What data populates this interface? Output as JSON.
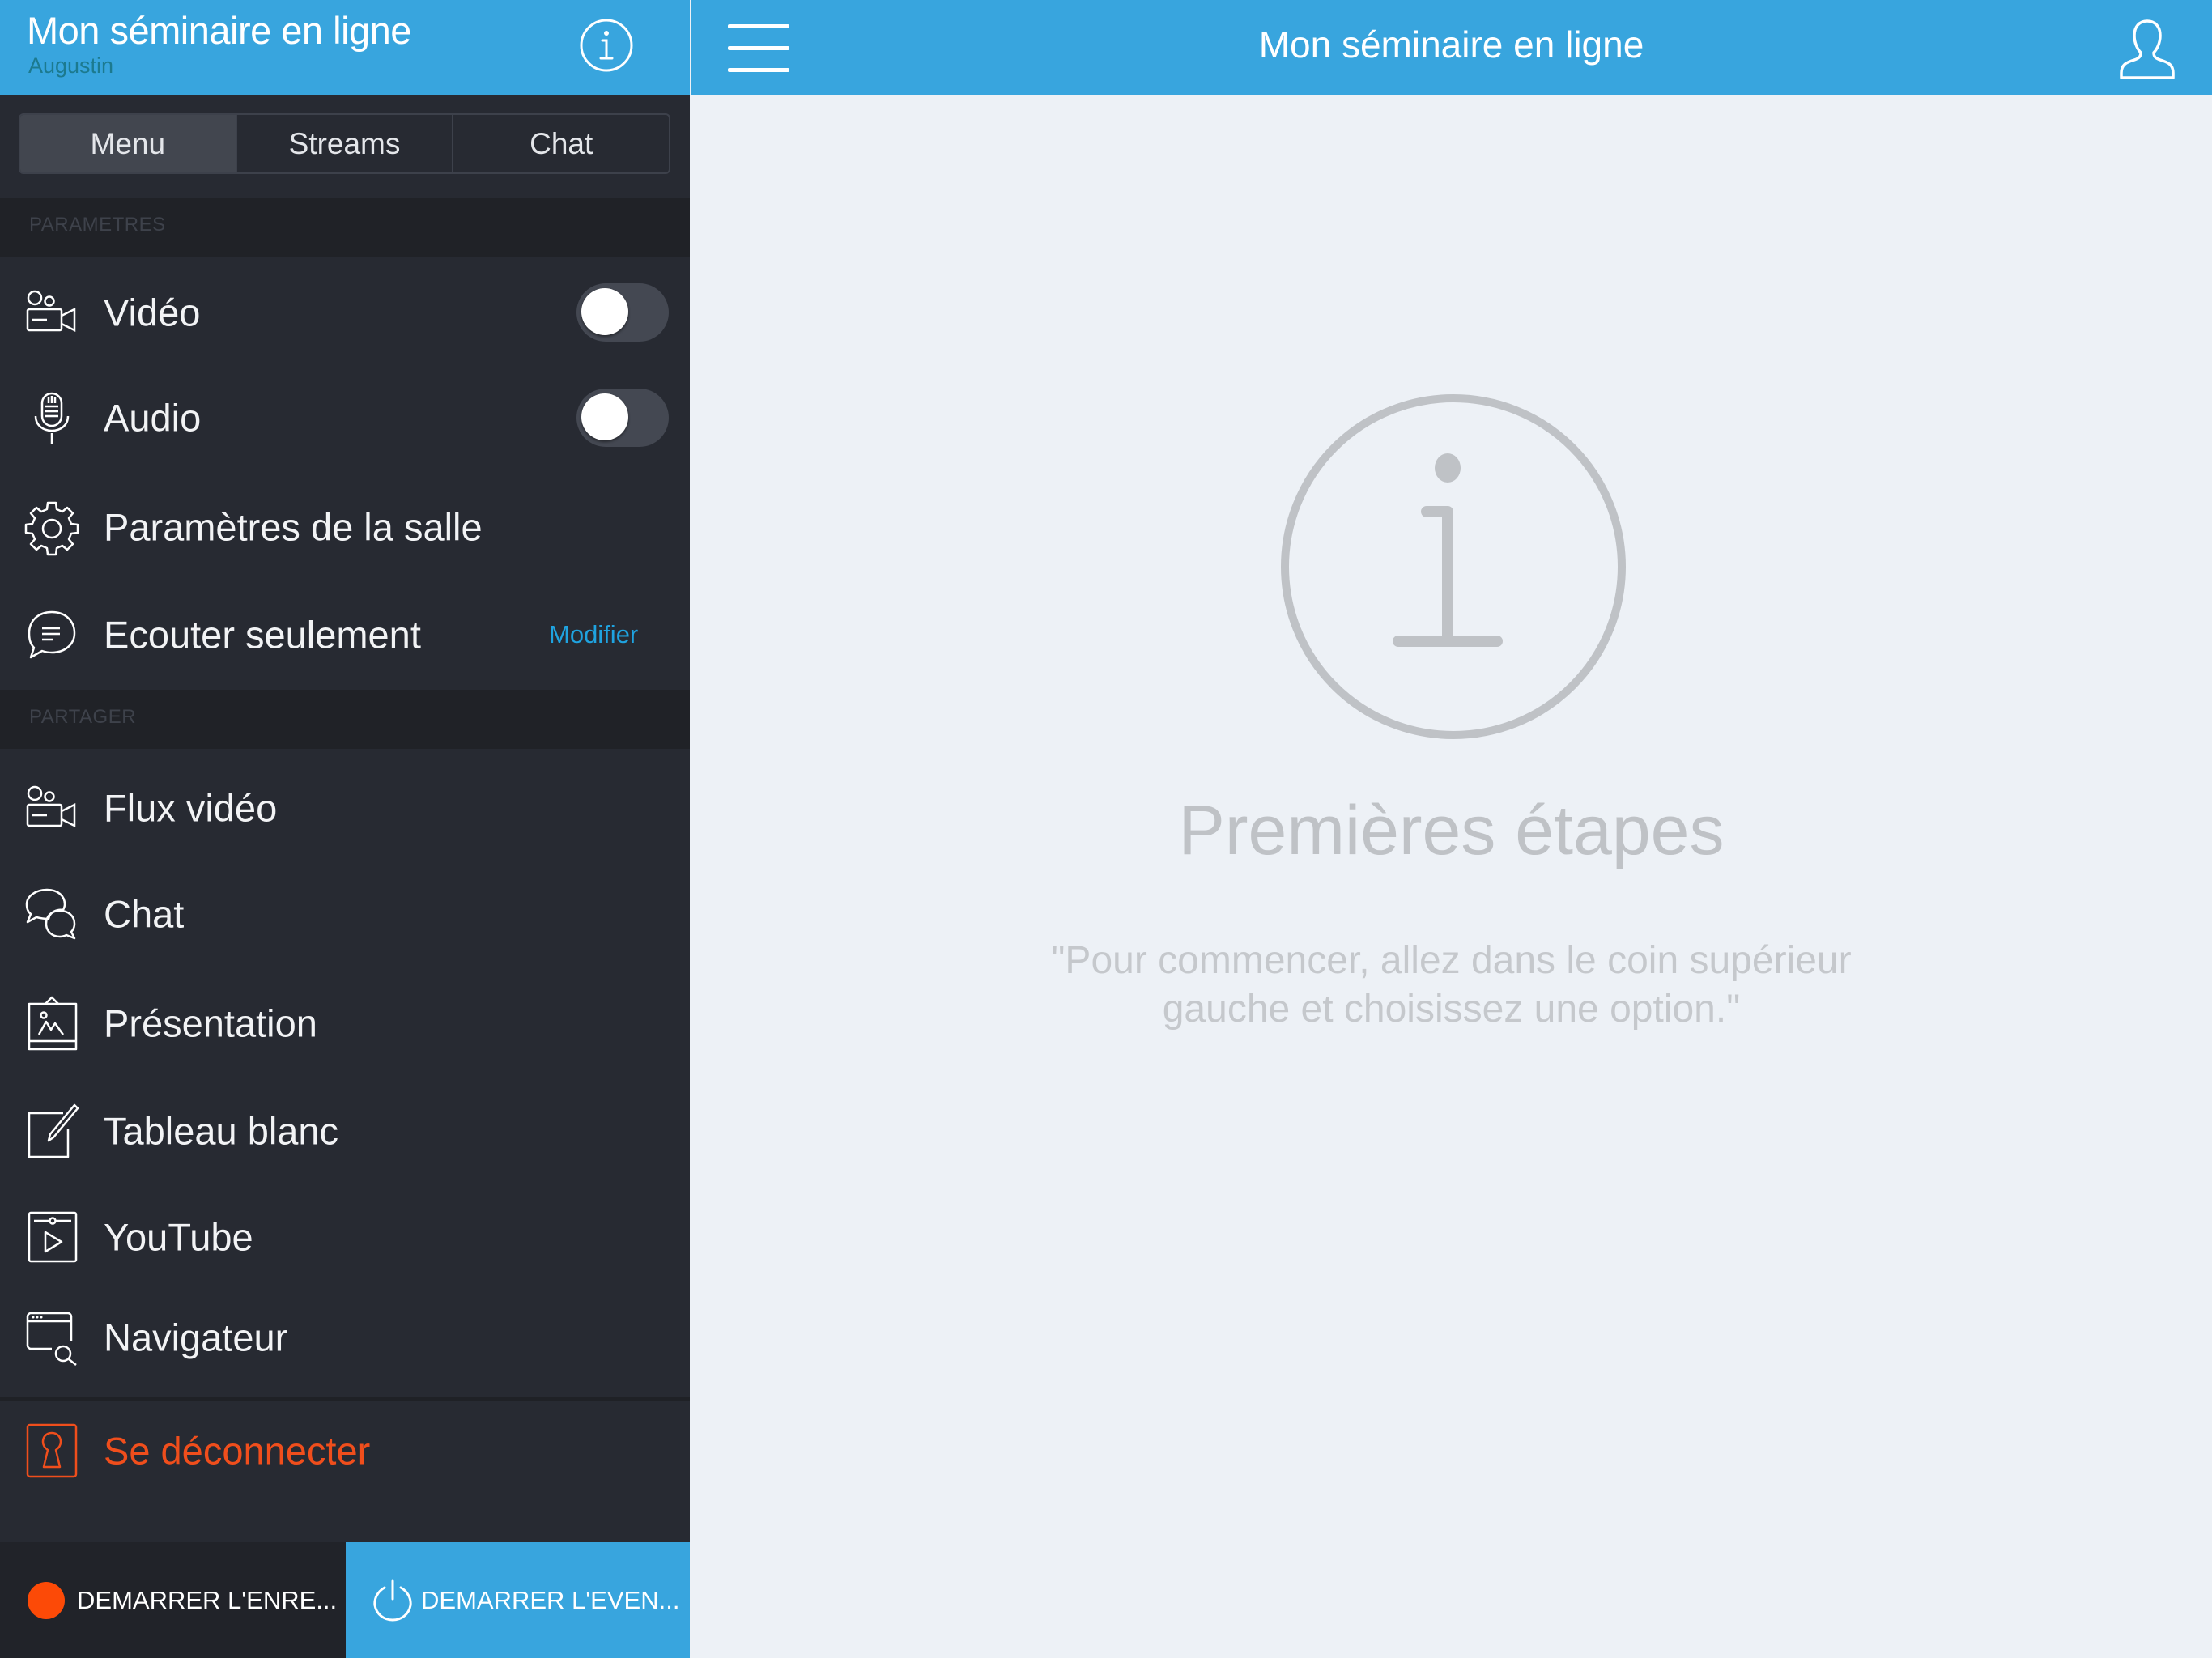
{
  "sidebar": {
    "header": {
      "title": "Mon séminaire en ligne",
      "subtitle": "Augustin",
      "info_icon": "info-circle-icon"
    },
    "tabs": [
      {
        "label": "Menu",
        "active": true
      },
      {
        "label": "Streams",
        "active": false
      },
      {
        "label": "Chat",
        "active": false
      }
    ],
    "sections": {
      "settings": {
        "title": "PARAMETRES",
        "items": [
          {
            "label": "Vidéo",
            "icon": "video-camera-icon",
            "toggle": false
          },
          {
            "label": "Audio",
            "icon": "microphone-icon",
            "toggle": false
          },
          {
            "label": "Paramètres de la salle",
            "icon": "gear-icon"
          },
          {
            "label": "Ecouter seulement",
            "icon": "speech-bubble-icon",
            "action": "Modifier"
          }
        ]
      },
      "share": {
        "title": "PARTAGER",
        "items": [
          {
            "label": "Flux vidéo",
            "icon": "video-camera-icon"
          },
          {
            "label": "Chat",
            "icon": "chat-bubbles-icon"
          },
          {
            "label": "Présentation",
            "icon": "presentation-icon"
          },
          {
            "label": "Tableau blanc",
            "icon": "whiteboard-pencil-icon"
          },
          {
            "label": "YouTube",
            "icon": "video-player-icon"
          },
          {
            "label": "Navigateur",
            "icon": "browser-search-icon"
          }
        ]
      }
    },
    "logout": {
      "label": "Se déconnecter",
      "icon": "keyhole-icon"
    },
    "bottom": {
      "record_label": "DEMARRER L'ENRE...",
      "event_label": "DEMARRER L'EVEN..."
    }
  },
  "main": {
    "header": {
      "title": "Mon séminaire en ligne",
      "menu_icon": "hamburger-icon",
      "user_icon": "user-icon"
    },
    "empty_state": {
      "title": "Premières étapes",
      "line1": "\"Pour commencer, allez dans le coin supérieur",
      "line2": "gauche et choisissez une option.\""
    }
  },
  "colors": {
    "brand_blue": "#38a5de",
    "sidebar_bg": "#272a32",
    "danger": "#f04e1c",
    "record_dot": "#fc4a07",
    "link": "#1fa3e0"
  }
}
